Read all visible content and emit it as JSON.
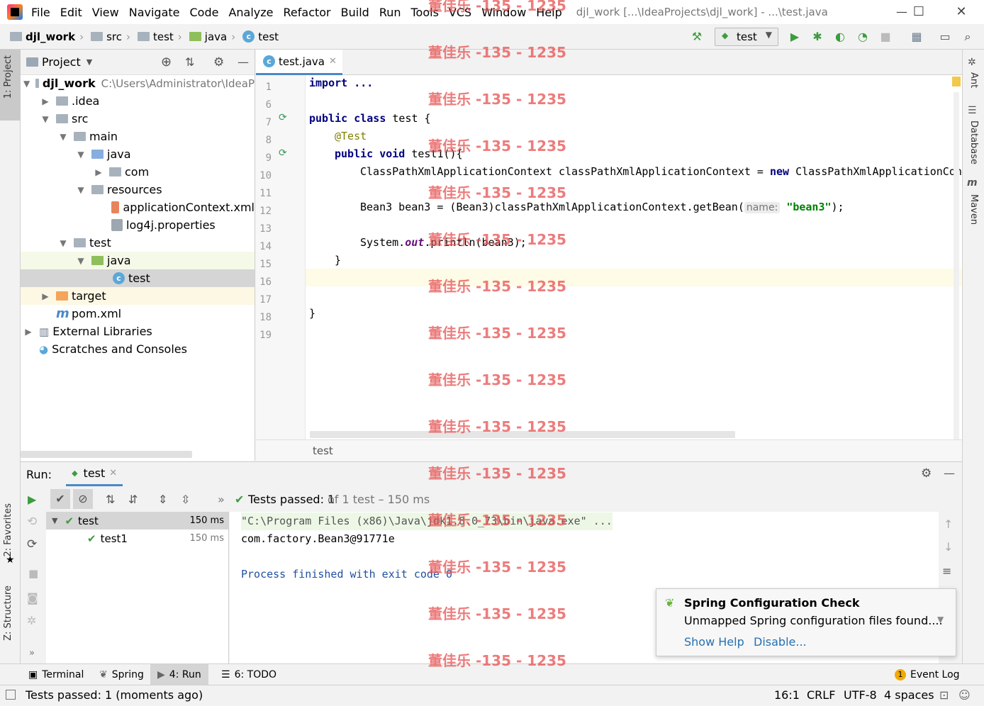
{
  "menu": [
    "File",
    "Edit",
    "View",
    "Navigate",
    "Code",
    "Analyze",
    "Refactor",
    "Build",
    "Run",
    "Tools",
    "VCS",
    "Window",
    "Help"
  ],
  "window_title": "djl_work [...\\IdeaProjects\\djl_work] - ...\\test.java",
  "breadcrumb": [
    "djl_work",
    "src",
    "test",
    "java",
    "test"
  ],
  "run_config": "test",
  "project_panel": {
    "title": "Project",
    "root_name": "djl_work",
    "root_path": "C:\\Users\\Administrator\\IdeaP",
    "items": [
      ".idea",
      "src",
      "main",
      "java",
      "com",
      "resources",
      "applicationContext.xml",
      "log4j.properties",
      "test",
      "java",
      "test",
      "target",
      "pom.xml",
      "External Libraries",
      "Scratches and Consoles"
    ]
  },
  "left_tabs": [
    "1: Project",
    "2: Favorites",
    "Z: Structure"
  ],
  "right_tabs": [
    "Ant",
    "Database",
    "Maven"
  ],
  "editor": {
    "tab": "test.java",
    "line_numbers": [
      "1",
      "6",
      "7",
      "8",
      "9",
      "10",
      "11",
      "12",
      "13",
      "14",
      "15",
      "16",
      "17",
      "18",
      "19"
    ],
    "code": {
      "l1": "import ...",
      "l7_kw": "public class",
      "l7_rest": " test {",
      "l8": "@Test",
      "l9_kw": "public void",
      "l9_rest": " test1(){",
      "l10_a": "ClassPathXmlApplicationContext classPathXmlApplicationContext = ",
      "l10_kw": "new",
      "l10_b": " ClassPathXmlApplicationCont",
      "l12_a": "Bean3 bean3 = (Bean3)classPathXmlApplicationContext.getBean(",
      "l12_hint": "name:",
      "l12_str": "\"bean3\"",
      "l12_end": ");",
      "l14_a": "System.",
      "l14_static": "out",
      "l14_b": ".println(bean3);",
      "l15": "}",
      "l18": "}"
    },
    "footer": "test"
  },
  "run_panel": {
    "label": "Run:",
    "tab": "test",
    "status_strong": "Tests passed: 1",
    "status_rest": " of 1 test – 150 ms",
    "tree": [
      {
        "name": "test",
        "time": "150 ms"
      },
      {
        "name": "test1",
        "time": "150 ms"
      }
    ],
    "console": [
      "\"C:\\Program Files (x86)\\Java\\jdk1.8.0_73\\bin\\java.exe\" ...",
      "com.factory.Bean3@91771e",
      "",
      "Process finished with exit code 0"
    ]
  },
  "notification": {
    "title": "Spring Configuration Check",
    "body": "Unmapped Spring configuration files found....",
    "link1": "Show Help",
    "link2": "Disable..."
  },
  "bottom_tabs": [
    "Terminal",
    "Spring",
    "4: Run",
    "6: TODO"
  ],
  "event_log": {
    "badge": "1",
    "label": "Event Log"
  },
  "status": {
    "message": "Tests passed: 1 (moments ago)",
    "position": "16:1",
    "line_sep": "CRLF",
    "encoding": "UTF-8",
    "indent": "4 spaces"
  },
  "watermark": "董佳乐 -135 - 1235"
}
